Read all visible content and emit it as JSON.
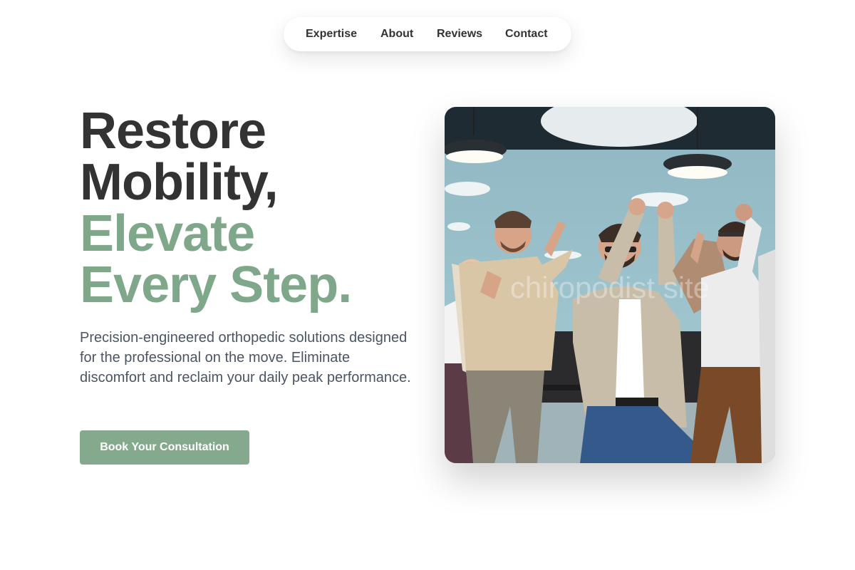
{
  "nav": {
    "items": [
      {
        "label": "Expertise"
      },
      {
        "label": "About"
      },
      {
        "label": "Reviews"
      },
      {
        "label": "Contact"
      }
    ]
  },
  "hero": {
    "heading_line1": "Restore",
    "heading_line2": "Mobility,",
    "heading_line3": "Elevate",
    "heading_line4": "Every Step.",
    "description": "Precision-engineered orthopedic solutions designed for the professional on the move. Eliminate discomfort and reclaim your daily peak performance.",
    "cta_label": "Book Your Consultation"
  },
  "image": {
    "watermark": "chiropodist site",
    "description_icon": "celebrating-team-photo"
  },
  "colors": {
    "text_dark": "#333333",
    "accent_green": "#7fa88a",
    "button_green": "#85a98c",
    "body_text": "#4b5563"
  }
}
